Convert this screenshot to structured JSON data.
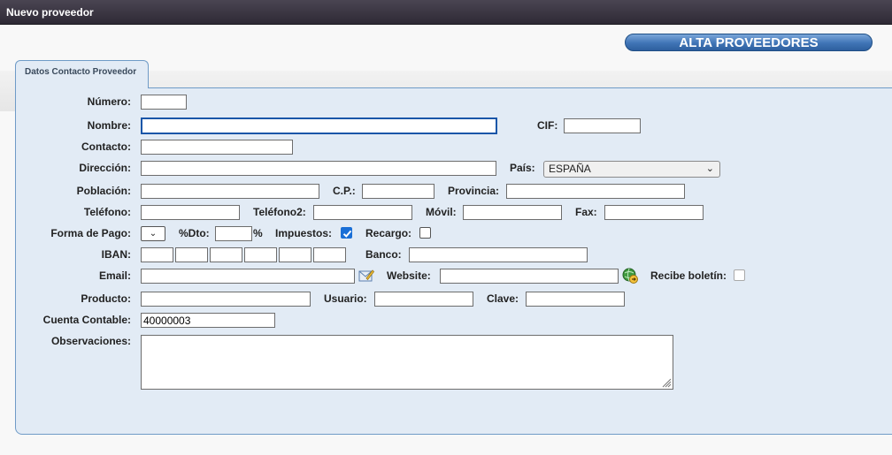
{
  "window": {
    "title": "Nuevo proveedor"
  },
  "header": {
    "button_label": "ALTA PROVEEDORES"
  },
  "tabs": [
    {
      "label": "Datos Contacto Proveedor"
    }
  ],
  "labels": {
    "numero": "Número:",
    "nombre": "Nombre:",
    "cif": "CIF:",
    "contacto": "Contacto:",
    "direccion": "Dirección:",
    "pais": "País:",
    "poblacion": "Población:",
    "cp": "C.P.:",
    "provincia": "Provincia:",
    "telefono": "Teléfono:",
    "telefono2": "Teléfono2:",
    "movil": "Móvil:",
    "fax": "Fax:",
    "forma_pago": "Forma de Pago:",
    "dto": "%Dto:",
    "percent": "%",
    "impuestos": "Impuestos:",
    "recargo": "Recargo:",
    "iban": "IBAN:",
    "banco": "Banco:",
    "email": "Email:",
    "website": "Website:",
    "recibe_boletin": "Recibe boletín:",
    "producto": "Producto:",
    "usuario": "Usuario:",
    "clave": "Clave:",
    "cuenta_contable": "Cuenta Contable:",
    "observaciones": "Observaciones:"
  },
  "fields": {
    "pais": "ESPAÑA",
    "cuenta_contable": "40000003"
  },
  "checkboxes": {
    "impuestos": true,
    "recargo": false,
    "recibe_boletin": false
  },
  "icons": {
    "email_action": "edit-email-icon",
    "website_action": "open-website-globe-icon",
    "select_chevron": "chevron-down-icon"
  },
  "colors": {
    "titlebar": "#3a3642",
    "accent": "#2e5f9e",
    "panel": "#e2ebf5",
    "checkbox_on": "#1a6fd6"
  }
}
